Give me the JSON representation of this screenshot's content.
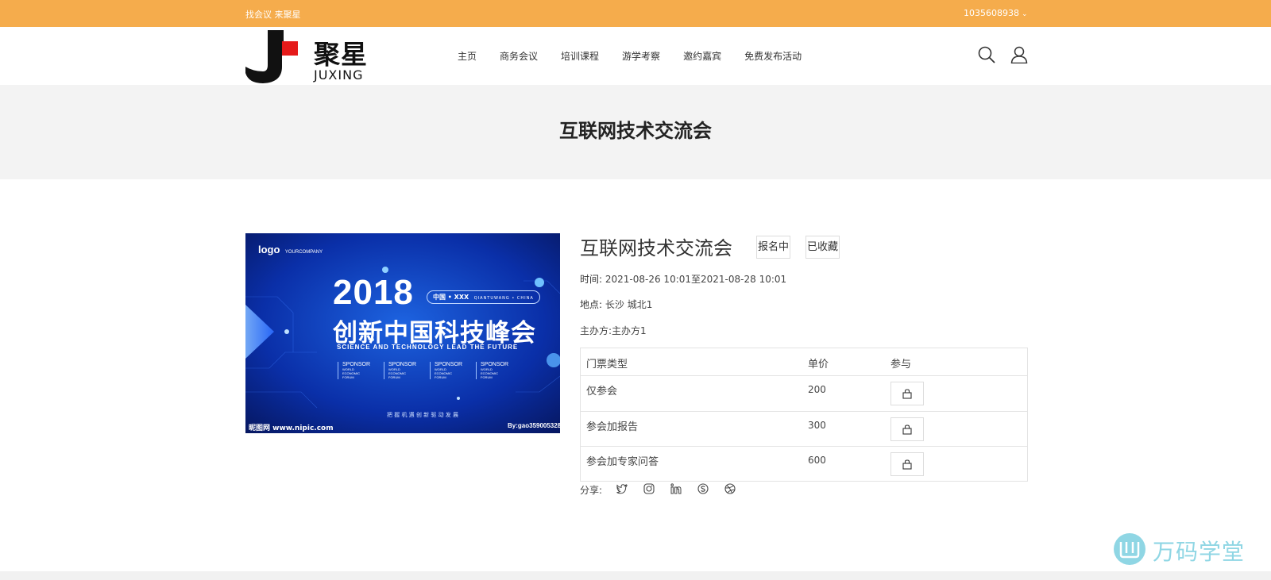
{
  "topbar": {
    "slogan": "找会议 来聚星",
    "account": "1035608938",
    "color": "#f5ac4c"
  },
  "logo": {
    "cn": "聚星",
    "en": "JUXING"
  },
  "nav": [
    {
      "label": "主页"
    },
    {
      "label": "商务会议"
    },
    {
      "label": "培训课程"
    },
    {
      "label": "游学考察"
    },
    {
      "label": "邀约嘉宾"
    },
    {
      "label": "免费发布活动"
    }
  ],
  "header_icons": [
    "search-icon",
    "user-icon"
  ],
  "page_title": "互联网技术交流会",
  "event": {
    "title": "互联网技术交流会",
    "status_tag": "报名中",
    "favorite_tag": "已收藏",
    "time_label": "时间:",
    "time_value": "2021-08-26 10:01至2021-08-28 10:01",
    "location_label": "地点:",
    "location_value": "长沙 城北1",
    "organizer": "主办方:主办方1",
    "image": {
      "logo_text": "logo",
      "company": "YOURCOMPANY",
      "year": "2018",
      "headline": "创新中国科技峰会",
      "badge": "中国 • XXX",
      "badge_sub": "QIANTUWANG • CHINA",
      "tagline": "SCIENCE AND TECHNOLOGY LEAD THE FUTURE",
      "sponsor": "SPONSOR",
      "sponsor_sub": "WORLD ECONOMIC FORUM",
      "bottom_cn": "把 握 机 遇 创 新 驱 动 发 展",
      "site": "昵图网 www.nipic.com",
      "credit": "By:gao359005328"
    }
  },
  "tickets": {
    "headers": {
      "type": "门票类型",
      "price": "单价",
      "join": "参与"
    },
    "rows": [
      {
        "type": "仅参会",
        "price": "200"
      },
      {
        "type": "参会加报告",
        "price": "300"
      },
      {
        "type": "参会加专家问答",
        "price": "600"
      }
    ]
  },
  "share": {
    "label": "分享:",
    "icons": [
      "twitter-icon",
      "instagram-icon",
      "linkedin-icon",
      "skype-icon",
      "dribbble-icon"
    ]
  },
  "watermark": {
    "text": "万码学堂"
  }
}
